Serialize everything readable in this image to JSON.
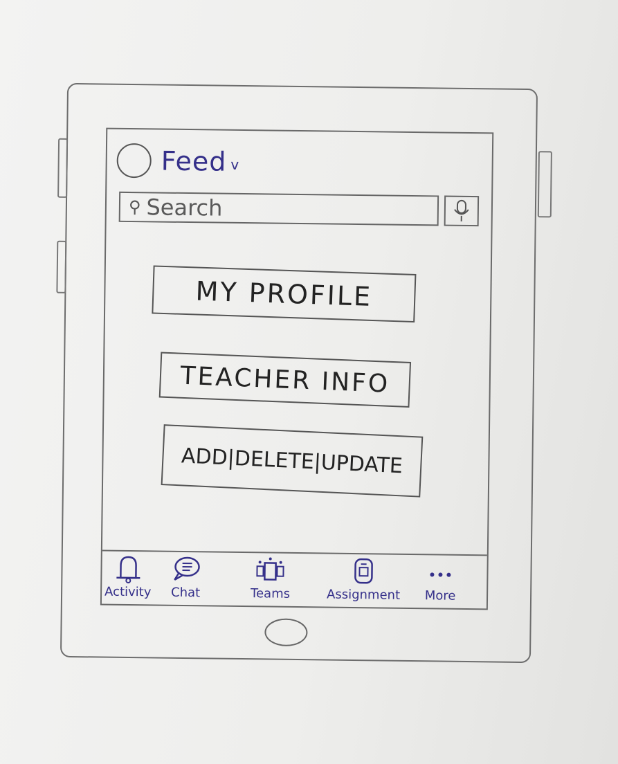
{
  "header": {
    "feed_label": "Feed",
    "feed_chevron": "v"
  },
  "search": {
    "placeholder": "Search"
  },
  "main": {
    "buttons": [
      {
        "label": "MY PROFILE"
      },
      {
        "label": "TEACHER INFO"
      },
      {
        "label": "ADD|DELETE|UPDATE"
      }
    ]
  },
  "tabbar": {
    "items": [
      {
        "label": "Activity",
        "icon": "bell-icon"
      },
      {
        "label": "Chat",
        "icon": "chat-bubble-icon"
      },
      {
        "label": "Teams",
        "icon": "teams-icon"
      },
      {
        "label": "Assignment",
        "icon": "assignment-icon"
      },
      {
        "label": "More",
        "icon": "more-dots-icon"
      }
    ]
  },
  "colors": {
    "ink_blue": "#35308a",
    "pencil": "#6a6a6a"
  }
}
